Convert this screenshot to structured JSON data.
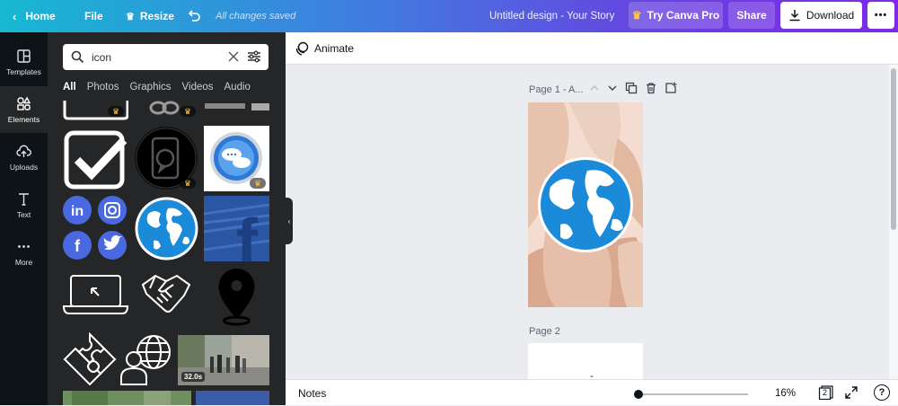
{
  "topbar": {
    "home_label": "Home",
    "file_label": "File",
    "resize_label": "Resize",
    "saved_status": "All changes saved",
    "design_title": "Untitled design - Your Story",
    "try_pro_label": "Try Canva Pro",
    "share_label": "Share",
    "download_label": "Download",
    "more_label": "•••"
  },
  "rail": {
    "items": [
      {
        "label": "Templates",
        "icon": "templates-icon"
      },
      {
        "label": "Elements",
        "icon": "elements-icon"
      },
      {
        "label": "Uploads",
        "icon": "uploads-icon"
      },
      {
        "label": "Text",
        "icon": "text-icon"
      },
      {
        "label": "More",
        "icon": "more-icon"
      }
    ]
  },
  "panel": {
    "search_value": "icon",
    "tabs": [
      "All",
      "Photos",
      "Graphics",
      "Videos",
      "Audio"
    ],
    "video_duration": "32.0s"
  },
  "editor": {
    "animate_label": "Animate",
    "page1_label": "Page 1 - A...",
    "page2_label": "Page 2"
  },
  "bottombar": {
    "notes_label": "Notes",
    "zoom_value": "16%",
    "page_count": "2",
    "help_label": "?"
  },
  "colors": {
    "gradient_start": "#17b8d2",
    "gradient_end": "#7d2ae8",
    "panel_bg": "#252627",
    "rail_bg": "#0e1318",
    "canvas_bg": "#ebecf0",
    "globe_blue": "#1b8ad8",
    "social_blue": "#4a68e0"
  }
}
